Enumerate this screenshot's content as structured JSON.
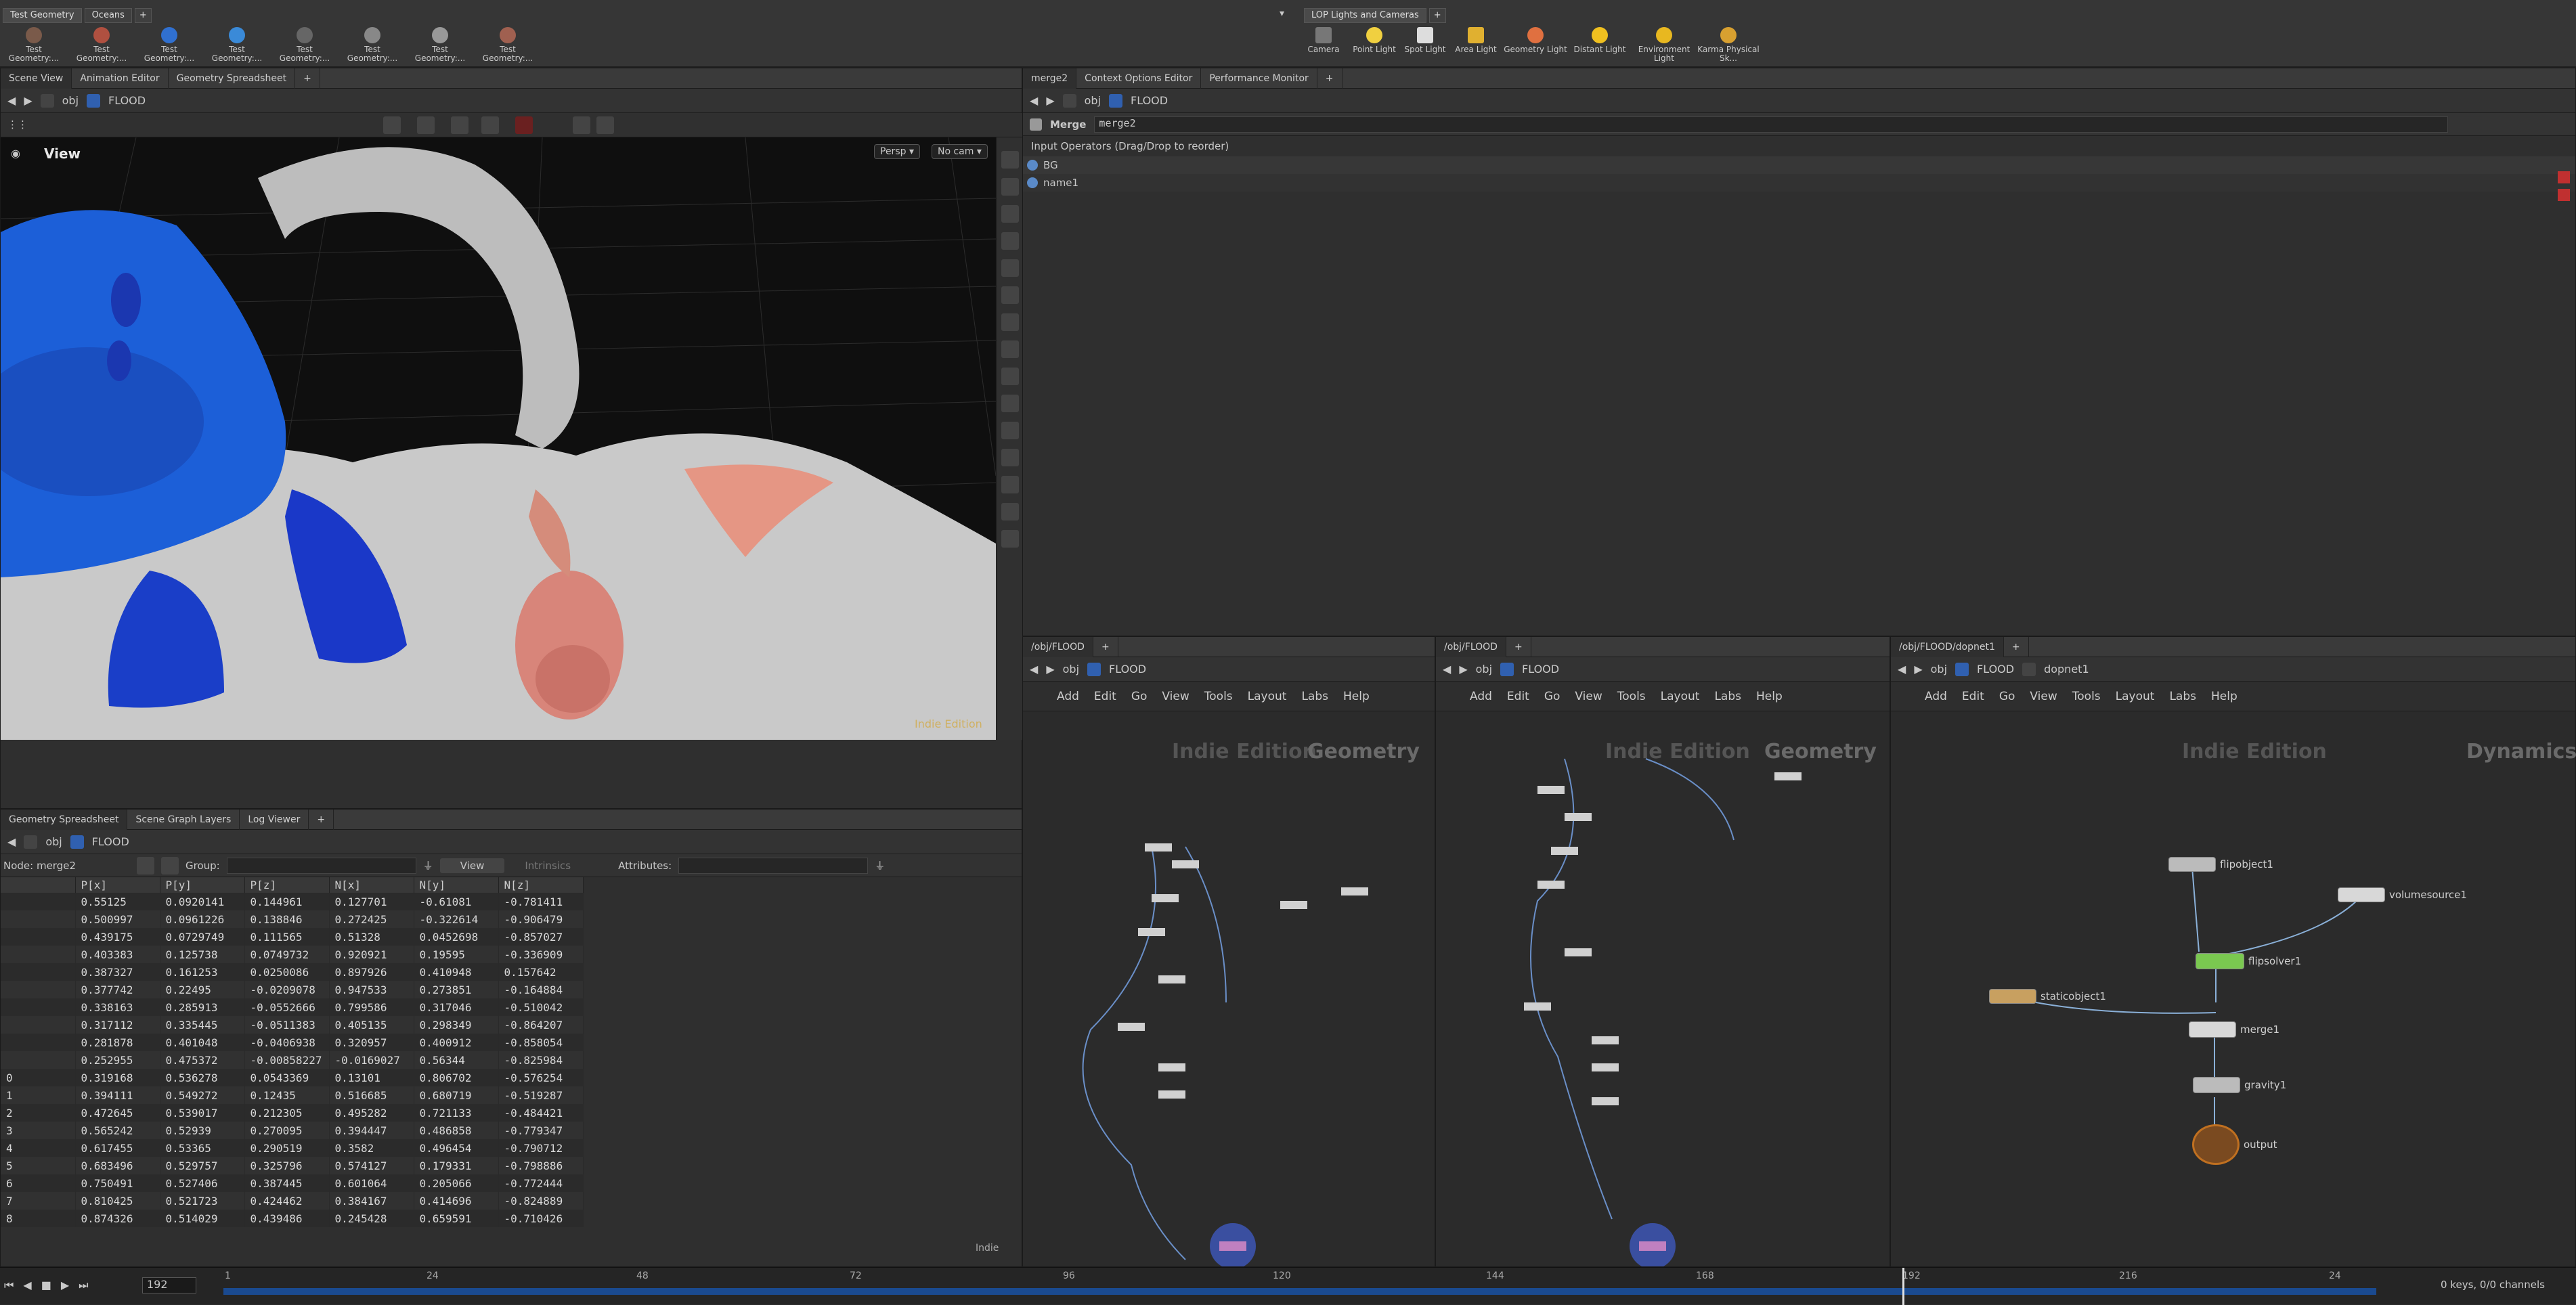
{
  "shelf": {
    "left_tabs": [
      "Test Geometry",
      "Oceans"
    ],
    "left_tools": [
      "Test Geometry:...",
      "Test Geometry:...",
      "Test Geometry:...",
      "Test Geometry:...",
      "Test Geometry:...",
      "Test Geometry:...",
      "Test Geometry:...",
      "Test Geometry:..."
    ],
    "right_tabs": [
      "LOP Lights and Cameras"
    ],
    "right_tools": [
      "Camera",
      "Point Light",
      "Spot Light",
      "Area Light",
      "Geometry Light",
      "Distant Light",
      "Environment Light",
      "Karma Physical Sk..."
    ]
  },
  "scene_pane": {
    "tabs": [
      "Scene View",
      "Animation Editor",
      "Geometry Spreadsheet"
    ],
    "path": {
      "context": "obj",
      "node": "FLOOD"
    },
    "view_label": "View",
    "persp": "Persp",
    "cam": "No cam",
    "watermark": "Indie Edition"
  },
  "spreadsheet_pane": {
    "tabs": [
      "Geometry Spreadsheet",
      "Scene Graph Layers",
      "Log Viewer"
    ],
    "path": {
      "context": "obj",
      "node": "FLOOD"
    },
    "node_label": "Node: merge2",
    "group_label": "Group:",
    "view_label": "View",
    "intrinsics_label": "Intrinsics",
    "attributes_label": "Attributes:",
    "columns": [
      "",
      "P[x]",
      "P[y]",
      "P[z]",
      "N[x]",
      "N[y]",
      "N[z]"
    ],
    "rows": [
      [
        "",
        "0.55125",
        "0.0920141",
        "0.144961",
        "0.127701",
        "-0.61081",
        "-0.781411"
      ],
      [
        "",
        "0.500997",
        "0.0961226",
        "0.138846",
        "0.272425",
        "-0.322614",
        "-0.906479"
      ],
      [
        "",
        "0.439175",
        "0.0729749",
        "0.111565",
        "0.51328",
        "0.0452698",
        "-0.857027"
      ],
      [
        "",
        "0.403383",
        "0.125738",
        "0.0749732",
        "0.920921",
        "0.19595",
        "-0.336909"
      ],
      [
        "",
        "0.387327",
        "0.161253",
        "0.0250086",
        "0.897926",
        "0.410948",
        "0.157642"
      ],
      [
        "",
        "0.377742",
        "0.22495",
        "-0.0209078",
        "0.947533",
        "0.273851",
        "-0.164884"
      ],
      [
        "",
        "0.338163",
        "0.285913",
        "-0.0552666",
        "0.799586",
        "0.317046",
        "-0.510042"
      ],
      [
        "",
        "0.317112",
        "0.335445",
        "-0.0511383",
        "0.405135",
        "0.298349",
        "-0.864207"
      ],
      [
        "",
        "0.281878",
        "0.401048",
        "-0.0406938",
        "0.320957",
        "0.400912",
        "-0.858054"
      ],
      [
        "",
        "0.252955",
        "0.475372",
        "-0.00858227",
        "-0.0169027",
        "0.56344",
        "-0.825984"
      ],
      [
        "0",
        "0.319168",
        "0.536278",
        "0.0543369",
        "0.13101",
        "0.806702",
        "-0.576254"
      ],
      [
        "1",
        "0.394111",
        "0.549272",
        "0.12435",
        "0.516685",
        "0.680719",
        "-0.519287"
      ],
      [
        "2",
        "0.472645",
        "0.539017",
        "0.212305",
        "0.495282",
        "0.721133",
        "-0.484421"
      ],
      [
        "3",
        "0.565242",
        "0.52939",
        "0.270095",
        "0.394447",
        "0.486858",
        "-0.779347"
      ],
      [
        "4",
        "0.617455",
        "0.53365",
        "0.290519",
        "0.3582",
        "0.496454",
        "-0.790712"
      ],
      [
        "5",
        "0.683496",
        "0.529757",
        "0.325796",
        "0.574127",
        "0.179331",
        "-0.798886"
      ],
      [
        "6",
        "0.750491",
        "0.527406",
        "0.387445",
        "0.601064",
        "0.205066",
        "-0.772444"
      ],
      [
        "7",
        "0.810425",
        "0.521723",
        "0.424462",
        "0.384167",
        "0.414696",
        "-0.824889"
      ],
      [
        "8",
        "0.874326",
        "0.514029",
        "0.439486",
        "0.245428",
        "0.659591",
        "-0.710426"
      ]
    ],
    "watermark": "Indie"
  },
  "param_pane": {
    "tabs": [
      "merge2",
      "Context Options Editor",
      "Performance Monitor"
    ],
    "path": {
      "context": "obj",
      "node": "FLOOD"
    },
    "op_type": "Merge",
    "op_name": "merge2",
    "input_header": "Input Operators (Drag/Drop to reorder)",
    "inputs": [
      "BG",
      "name1"
    ]
  },
  "net1": {
    "tab": "/obj/FLOOD",
    "path": {
      "context": "obj",
      "node": "FLOOD"
    },
    "menu": [
      "Add",
      "Edit",
      "Go",
      "View",
      "Tools",
      "Layout",
      "Labs",
      "Help"
    ],
    "watermark": "Indie Edition",
    "context_label": "Geometry"
  },
  "net2": {
    "tab": "/obj/FLOOD",
    "path": {
      "context": "obj",
      "node": "FLOOD"
    },
    "menu": [
      "Add",
      "Edit",
      "Go",
      "View",
      "Tools",
      "Layout",
      "Labs",
      "Help"
    ],
    "watermark": "Indie Edition",
    "context_label": "Geometry"
  },
  "net3": {
    "tab": "/obj/FLOOD/dopnet1",
    "path": {
      "context": "obj",
      "node": "FLOOD",
      "sub": "dopnet1"
    },
    "menu": [
      "Add",
      "Edit",
      "Go",
      "View",
      "Tools",
      "Layout",
      "Labs",
      "Help"
    ],
    "watermark": "Indie Edition",
    "context_label": "Dynamics",
    "nodes": {
      "flipobject": "flipobject1",
      "volumesource": "volumesource1",
      "flipsolver": "flipsolver1",
      "staticobject": "staticobject1",
      "merge": "merge1",
      "gravity": "gravity1",
      "output": "output"
    }
  },
  "timeline": {
    "frame": "192",
    "ticks": [
      "1",
      "24",
      "48",
      "72",
      "96",
      "120",
      "144",
      "168",
      "192",
      "216",
      "24"
    ],
    "keys": "0 keys, 0/0 channels"
  }
}
